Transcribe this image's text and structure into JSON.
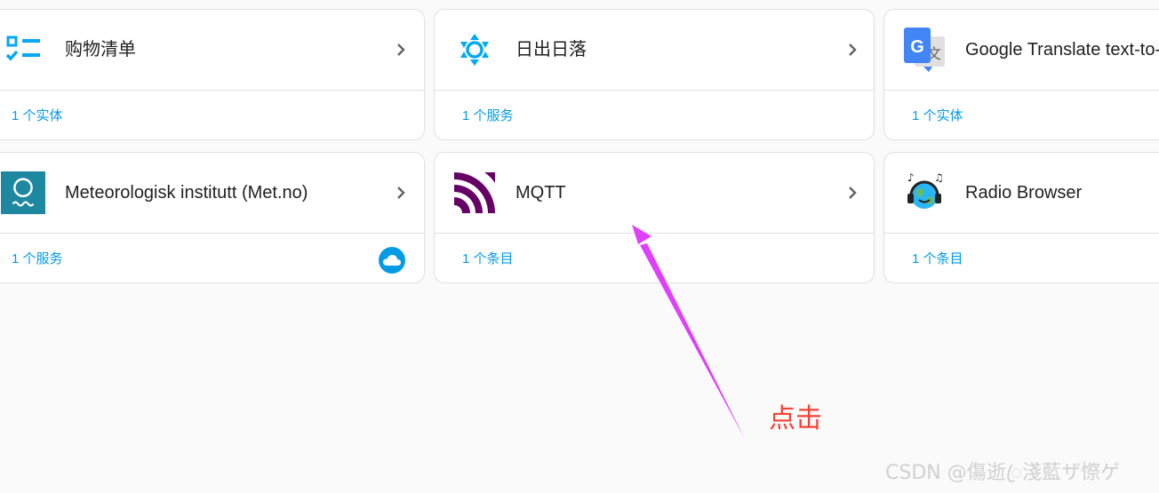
{
  "colors": {
    "page_background": "#fafafa",
    "card_background": "#ffffff",
    "card_border": "#e0e0e0",
    "link": "#039be5",
    "title": "#212121",
    "chevron": "#616161",
    "annotation_arrow": "#e040fb",
    "annotation_text": "#f44336",
    "mqtt_brand": "#660066",
    "met_brand": "#1e88a0"
  },
  "integrations": [
    {
      "title": "购物清单",
      "icon": "checklist-icon",
      "footer_link": "1 个实体",
      "has_chevron": true
    },
    {
      "title": "日出日落",
      "icon": "sun-icon",
      "footer_link": "1 个服务",
      "has_chevron": true
    },
    {
      "title": "Google Translate text-to-",
      "icon": "google-translate-icon",
      "footer_link": "1 个实体",
      "has_chevron": false
    },
    {
      "title": "Meteorologisk institutt (Met.no)",
      "icon": "met-no-icon",
      "footer_link": "1 个服务",
      "has_chevron": true,
      "badge": "cloud-icon"
    },
    {
      "title": "MQTT",
      "icon": "mqtt-icon",
      "footer_link": "1 个条目",
      "has_chevron": true
    },
    {
      "title": "Radio Browser",
      "icon": "radio-browser-icon",
      "footer_link": "1 个条目",
      "has_chevron": false
    }
  ],
  "annotation": {
    "text": "点击",
    "arrow_icon": "arrow-icon"
  },
  "watermark": {
    "text": "CSDN @傷逝ꦿ淺藍ザ憏ゲ"
  }
}
